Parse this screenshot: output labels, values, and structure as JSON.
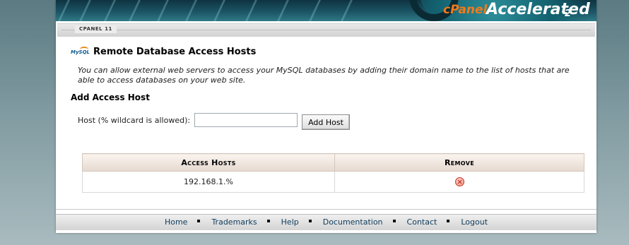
{
  "banner": {
    "brand_cpanel": "cPanel",
    "brand_accelerated": "Accelerated",
    "brand_version": "2"
  },
  "tabbar": {
    "label": "CPANEL 11"
  },
  "page": {
    "title": "Remote Database Access Hosts",
    "icon": "mysql-icon",
    "description": "You can allow external web servers to access your MySQL databases by adding their domain name to the list of hosts that are able to access databases on your web site."
  },
  "add_host": {
    "heading": "Add Access Host",
    "label": "Host (% wildcard is allowed):",
    "input_value": "",
    "button_label": "Add Host"
  },
  "hosts_table": {
    "columns": [
      "Access Hosts",
      "Remove"
    ],
    "rows": [
      {
        "host": "192.168.1.%",
        "remove_icon": "remove-icon"
      }
    ]
  },
  "footer": {
    "links": [
      "Home",
      "Trademarks",
      "Help",
      "Documentation",
      "Contact",
      "Logout"
    ]
  },
  "colors": {
    "link": "#0e3b5c",
    "remove_icon": "#c23a2a",
    "accent_orange": "#f07a1a"
  }
}
